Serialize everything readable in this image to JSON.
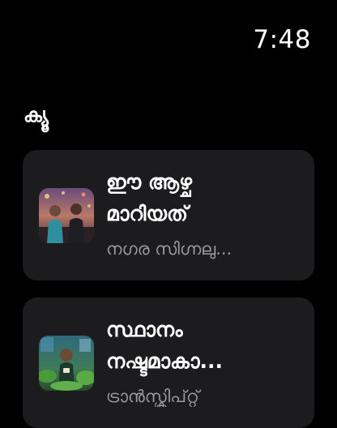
{
  "status_bar": {
    "time": "7:48"
  },
  "queue": {
    "heading": "ക്യൂ",
    "items": [
      {
        "title_line1": "ഈ ആഴ്ച",
        "title_line2": "മാറിയത്",
        "subtitle": "നഗര സിഗ്നലു...",
        "thumbnail_icon": "couple-city-night-thumbnail"
      },
      {
        "title_line1": "സ്ഥാനം",
        "title_line2": "നഷ്ടമാകാ...",
        "subtitle": "ട്രാൻസ്ക്രിപ്റ്റ്",
        "thumbnail_icon": "woman-plants-thumbnail"
      }
    ]
  }
}
